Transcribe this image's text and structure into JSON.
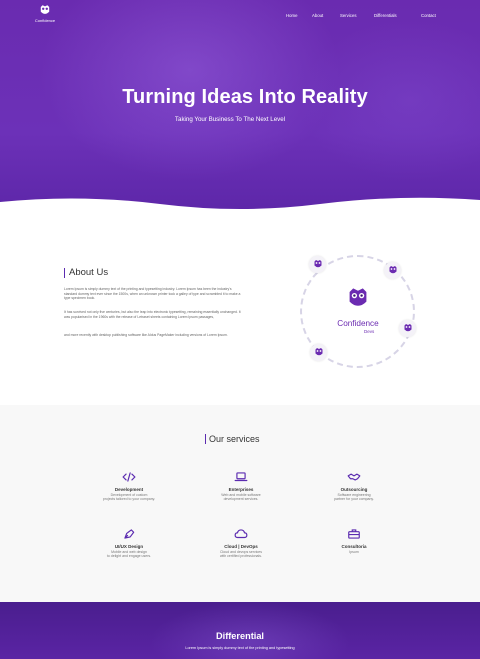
{
  "brand": {
    "name": "Confidence",
    "sub": "Devs"
  },
  "nav": {
    "home": "Home",
    "about": "About",
    "services": "Services",
    "differentials": "Differentials",
    "contact": "Contact"
  },
  "hero": {
    "title": "Turning Ideas Into Reality",
    "subtitle": "Taking Your Business To The Next Level"
  },
  "about": {
    "title": "About Us",
    "p1": "Lorem Ipsum is simply dummy text of the printing and typesetting industry. Lorem Ipsum has been the industry's standard dummy text ever since the 1500s, when an unknown printer took a galley of type and scrambled it to make a type specimen book.",
    "p2": "It has survived not only five centuries, but also the leap into electronic typesetting, remaining essentially unchanged. It was popularised in the 1960s with the release of Letraset sheets containing Lorem Ipsum passages,",
    "p3": " and more recently with desktop publishing software like Aldus PageMaker including versions of Lorem Ipsum."
  },
  "services": {
    "title": "Our services",
    "items": [
      {
        "title": "Development",
        "desc1": "Development of custom",
        "desc2": "projects tailored to your company.",
        "icon": "code-icon"
      },
      {
        "title": "Enterprises",
        "desc1": "Web and mobile software",
        "desc2": "development services.",
        "icon": "laptop-icon"
      },
      {
        "title": "Outsourcing",
        "desc1": "Software engineering",
        "desc2": "partner for your company.",
        "icon": "handshake-icon"
      },
      {
        "title": "UI/UX Design",
        "desc1": "Mobile and web design",
        "desc2": "to delight and engage users.",
        "icon": "pen-icon"
      },
      {
        "title": "Cloud | DevOps",
        "desc1": "Cloud and devops services",
        "desc2": "with certified professionals.",
        "icon": "cloud-icon"
      },
      {
        "title": "Consultoria",
        "desc1": "Ipsum",
        "desc2": "",
        "icon": "briefcase-icon"
      }
    ]
  },
  "differential": {
    "title": "Differential",
    "subtitle": "Lorem Ipsum is simply dummy text of the printing and typesetting"
  },
  "colors": {
    "accent": "#6b2bb1",
    "hero": "#6a2bb0",
    "servicesBg": "#f8f8f8"
  }
}
